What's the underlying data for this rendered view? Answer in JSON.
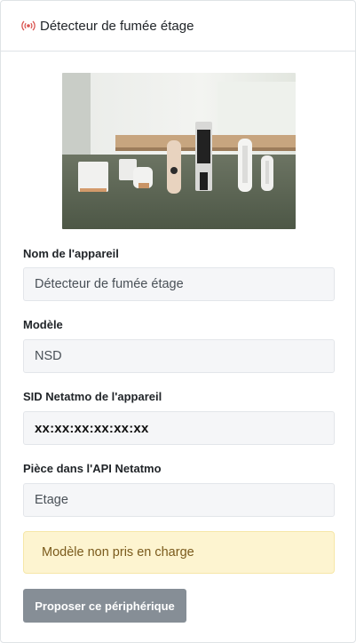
{
  "header": {
    "icon": "smoke-detector-signal-icon",
    "title": "Détecteur de fumée étage",
    "icon_color": "#d9534f"
  },
  "image": {
    "description_icon": "netatmo-products-photo"
  },
  "form": {
    "device_name": {
      "label": "Nom de l'appareil",
      "value": "Détecteur de fumée étage"
    },
    "model": {
      "label": "Modèle",
      "value": "NSD"
    },
    "sid": {
      "label": "SID Netatmo de l'appareil",
      "value": "xx:xx:xx:xx:xx:xx"
    },
    "room": {
      "label": "Pièce dans l'API Netatmo",
      "value": "Etage"
    }
  },
  "alert": {
    "text": "Modèle non pris en charge",
    "color": "#fdf4d0"
  },
  "actions": {
    "propose_label": "Proposer ce périphérique",
    "button_color": "#868e96"
  }
}
